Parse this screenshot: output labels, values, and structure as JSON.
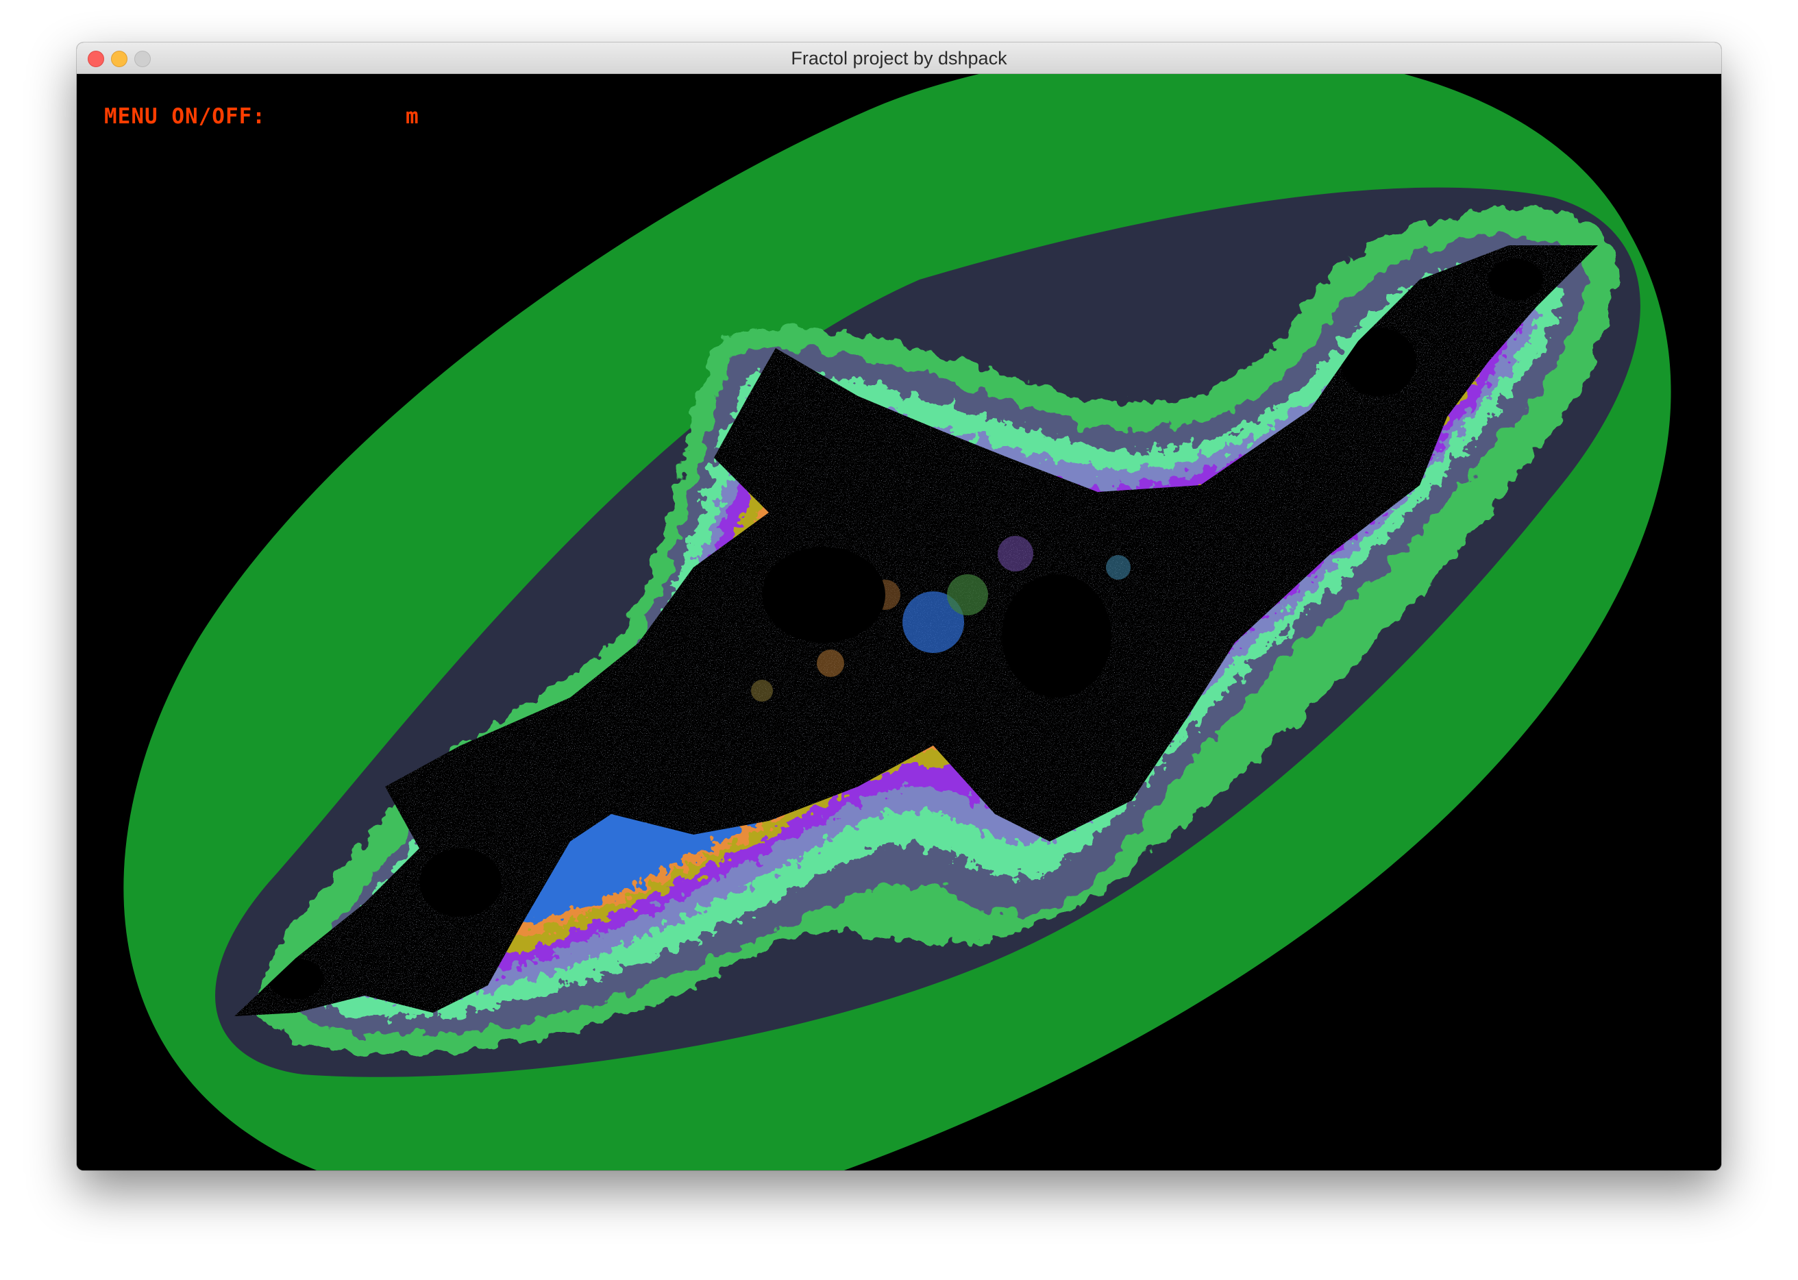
{
  "window": {
    "title": "Fractol project by dshpack"
  },
  "overlay": {
    "menu_label": "MENU ON/OFF:",
    "menu_key": "m"
  },
  "icons": [
    "close-icon",
    "minimize-icon",
    "maximize-icon"
  ],
  "colors": {
    "background": "#000000",
    "band_outer": "#16962a",
    "band_2": "#2b2f45",
    "band_3": "#3fbf5c",
    "band_4": "#525a7f",
    "band_5": "#62e39c",
    "band_6": "#7c84c4",
    "band_7": "#9330e0",
    "band_8": "#b5a71c",
    "band_9": "#e88d3a",
    "band_10": "#2f6fd8",
    "menu_text": "#ff3d00"
  }
}
